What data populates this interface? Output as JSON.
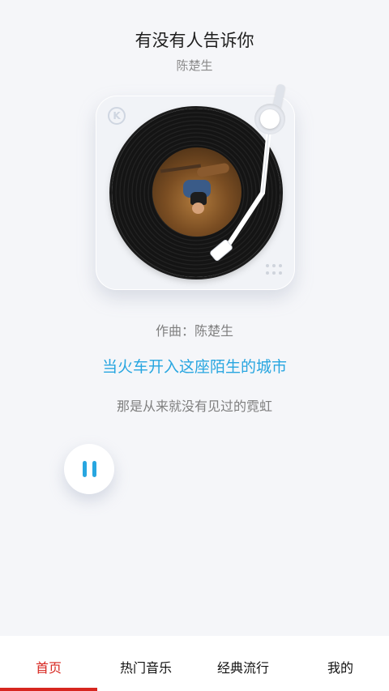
{
  "song": {
    "title": "有没有人告诉你",
    "artist": "陈楚生"
  },
  "turntable": {
    "logo_text": "K"
  },
  "lyrics": {
    "composer_line": "作曲：陈楚生",
    "current_line": "当火车开入这座陌生的城市",
    "next_line": "那是从来就没有见过的霓虹"
  },
  "player": {
    "state_icon": "pause-icon"
  },
  "tabbar": {
    "items": [
      {
        "label": "首页",
        "active": true
      },
      {
        "label": "热门音乐",
        "active": false
      },
      {
        "label": "经典流行",
        "active": false
      },
      {
        "label": "我的",
        "active": false
      }
    ]
  },
  "colors": {
    "accent_blue": "#28a6e0",
    "active_tab_red": "#d7261f",
    "background": "#f5f6f9"
  }
}
